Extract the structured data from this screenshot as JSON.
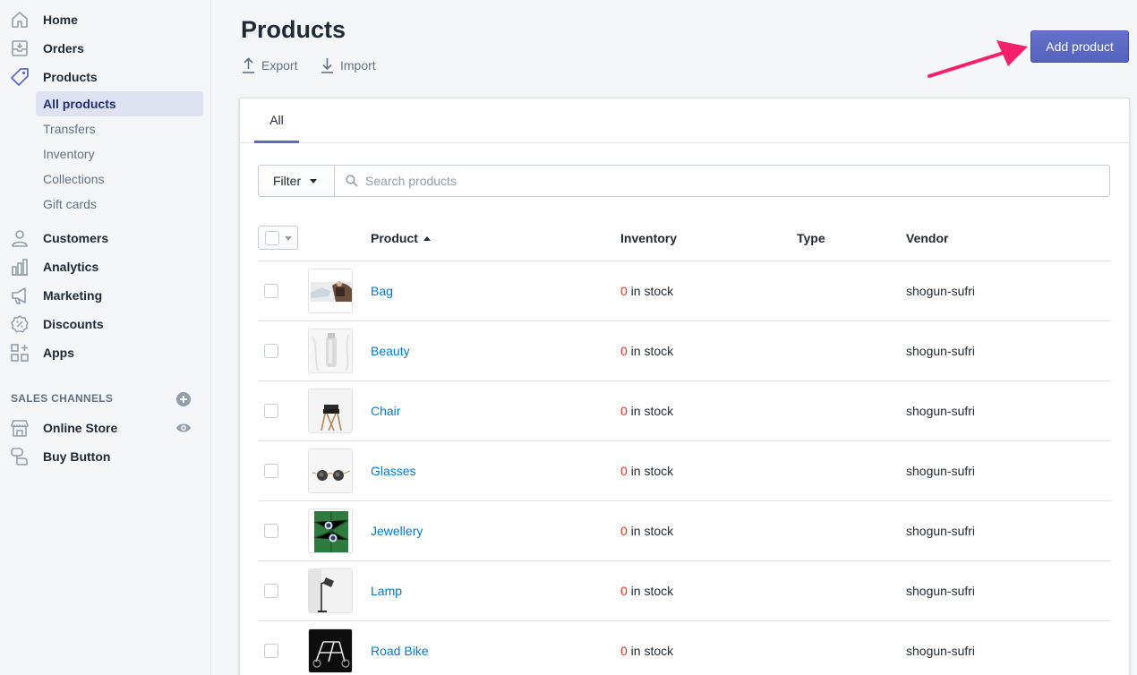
{
  "sidebar": {
    "items": [
      {
        "label": "Home",
        "icon": "home-icon"
      },
      {
        "label": "Orders",
        "icon": "orders-icon"
      },
      {
        "label": "Products",
        "icon": "tag-icon"
      },
      {
        "label": "Customers",
        "icon": "person-icon"
      },
      {
        "label": "Analytics",
        "icon": "bar-chart-icon"
      },
      {
        "label": "Marketing",
        "icon": "megaphone-icon"
      },
      {
        "label": "Discounts",
        "icon": "discount-icon"
      },
      {
        "label": "Apps",
        "icon": "apps-icon"
      }
    ],
    "products_sub": [
      {
        "label": "All products",
        "active": true
      },
      {
        "label": "Transfers"
      },
      {
        "label": "Inventory"
      },
      {
        "label": "Collections"
      },
      {
        "label": "Gift cards"
      }
    ],
    "sales_channels_title": "SALES CHANNELS",
    "channels": [
      {
        "label": "Online Store",
        "icon": "store-icon"
      },
      {
        "label": "Buy Button",
        "icon": "buy-button-icon"
      }
    ]
  },
  "header": {
    "title": "Products",
    "export_label": "Export",
    "import_label": "Import",
    "add_product_label": "Add product"
  },
  "tabs": [
    {
      "label": "All"
    }
  ],
  "filter": {
    "filter_label": "Filter",
    "search_placeholder": "Search products"
  },
  "table": {
    "columns": {
      "product": "Product",
      "inventory": "Inventory",
      "type": "Type",
      "vendor": "Vendor"
    },
    "rows": [
      {
        "name": "Bag",
        "inventory_count": "0",
        "inventory_suffix": " in stock",
        "type": "",
        "vendor": "shogun-sufri"
      },
      {
        "name": "Beauty",
        "inventory_count": "0",
        "inventory_suffix": " in stock",
        "type": "",
        "vendor": "shogun-sufri"
      },
      {
        "name": "Chair",
        "inventory_count": "0",
        "inventory_suffix": " in stock",
        "type": "",
        "vendor": "shogun-sufri"
      },
      {
        "name": "Glasses",
        "inventory_count": "0",
        "inventory_suffix": " in stock",
        "type": "",
        "vendor": "shogun-sufri"
      },
      {
        "name": "Jewellery",
        "inventory_count": "0",
        "inventory_suffix": " in stock",
        "type": "",
        "vendor": "shogun-sufri"
      },
      {
        "name": "Lamp",
        "inventory_count": "0",
        "inventory_suffix": " in stock",
        "type": "",
        "vendor": "shogun-sufri"
      },
      {
        "name": "Road Bike",
        "inventory_count": "0",
        "inventory_suffix": " in stock",
        "type": "",
        "vendor": "shogun-sufri"
      }
    ]
  },
  "colors": {
    "accent": "#5c6ac4",
    "link": "#007ace",
    "stock_zero": "#de3618",
    "annotation_arrow": "#f5206b"
  }
}
